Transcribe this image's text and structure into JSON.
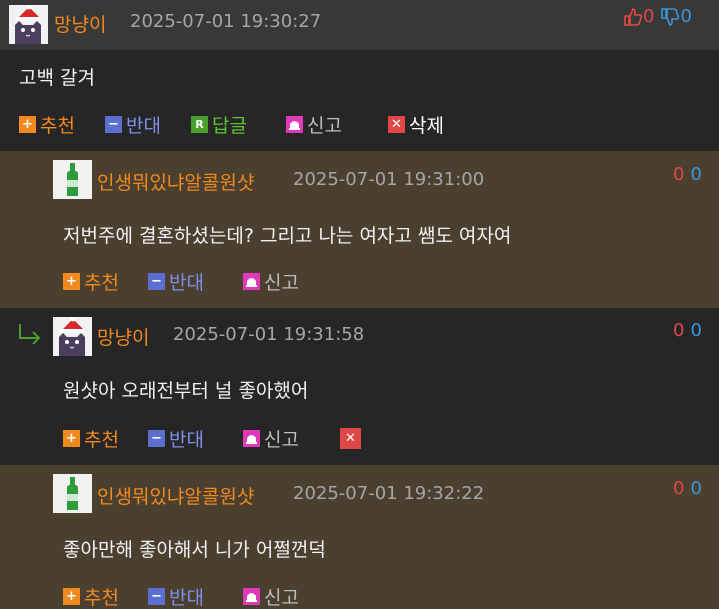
{
  "post": {
    "nickname": "망냥이",
    "time": "2025-07-01 19:30:27",
    "up_count": "0",
    "down_count": "0",
    "content": "고백 갈겨",
    "actions": {
      "up": "추천",
      "down": "반대",
      "reply": "답글",
      "report": "신고",
      "delete": "삭제"
    }
  },
  "comments": [
    {
      "nickname": "인생뭐있냐알콜원샷",
      "time": "2025-07-01 19:31:00",
      "up_count": "0",
      "down_count": "0",
      "content": "저번주에 결혼하셨는데? 그리고 나는 여자고 쌤도 여자여",
      "actions": {
        "up": "추천",
        "down": "반대",
        "report": "신고"
      }
    },
    {
      "nickname": "망냥이",
      "time": "2025-07-01 19:31:58",
      "up_count": "0",
      "down_count": "0",
      "content": "원샷아 오래전부터 널 좋아했어",
      "actions": {
        "up": "추천",
        "down": "반대",
        "report": "신고"
      }
    },
    {
      "nickname": "인생뭐있냐알콜원샷",
      "time": "2025-07-01 19:32:22",
      "up_count": "0",
      "down_count": "0",
      "content": "좋아만해 좋아해서 니가 어쩔껀덕",
      "actions": {
        "up": "추천",
        "down": "반대",
        "report": "신고"
      }
    }
  ],
  "colors": {
    "nickname": "#f08a1e",
    "up": "#f08a1e",
    "down": "#5c6fd0",
    "reply": "#4a9e2e",
    "report": "#e03ab8",
    "delete": "#e04848",
    "comment_bg": "#4b3f30",
    "header_bg": "#383838"
  },
  "icons": {
    "avatar_cat": "cat-santa-avatar-icon",
    "avatar_bottle": "soju-bottle-avatar-icon",
    "thumb_up": "thumbs-up-icon",
    "thumb_down": "thumbs-down-icon",
    "reply_arrow": "reply-arrow-icon"
  }
}
